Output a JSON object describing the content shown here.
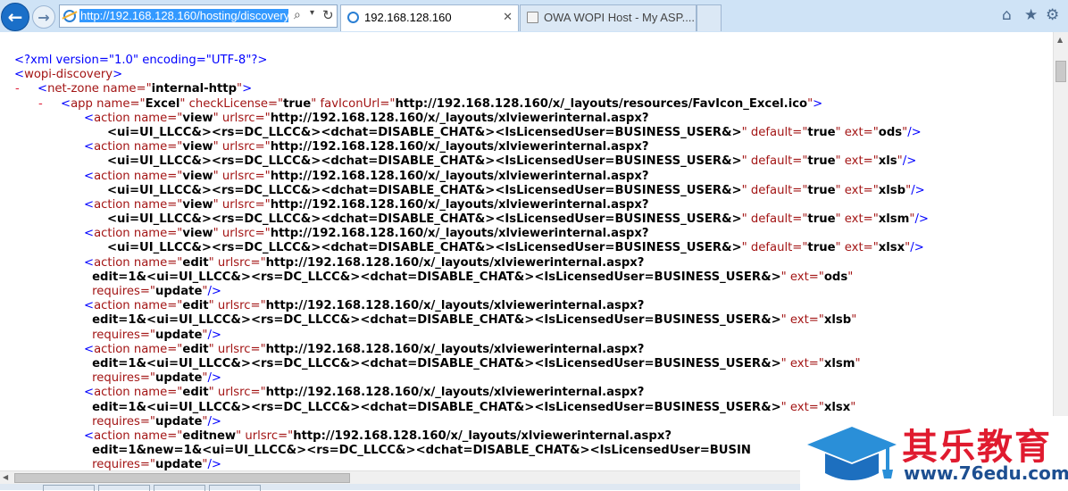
{
  "browser": {
    "address_url": "http://192.168.128.160/hosting/discovery",
    "tabs": [
      {
        "label": "192.168.128.160",
        "active": true,
        "close": "✕"
      },
      {
        "label": "OWA WOPI Host - My ASP....",
        "active": false
      }
    ],
    "icons": [
      "back-icon",
      "forward-icon",
      "search-icon",
      "refresh-icon",
      "home-icon",
      "star-icon",
      "gear-icon"
    ]
  },
  "xml": {
    "lines": [
      {
        "m": "",
        "i": 1,
        "t": [
          [
            "b",
            "<?xml version=\"1.0\" encoding=\"UTF-8\"?>"
          ]
        ]
      },
      {
        "m": "-",
        "i": 1,
        "t": [
          [
            "b",
            "<"
          ],
          [
            "r",
            "wopi-discovery"
          ],
          [
            "b",
            ">"
          ]
        ]
      },
      {
        "m": "-",
        "i": 2,
        "t": [
          [
            "b",
            "<"
          ],
          [
            "r",
            "net-zone"
          ],
          [
            "r",
            " name=\""
          ],
          [
            "k",
            "internal-http"
          ],
          [
            "r",
            "\""
          ],
          [
            "b",
            ">"
          ]
        ]
      },
      {
        "m": "-",
        "i": 3,
        "t": [
          [
            "b",
            "<"
          ],
          [
            "r",
            "app"
          ],
          [
            "r",
            " name=\""
          ],
          [
            "k",
            "Excel"
          ],
          [
            "r",
            "\" checkLicense=\""
          ],
          [
            "k",
            "true"
          ],
          [
            "r",
            "\" favIconUrl=\""
          ],
          [
            "k",
            "http://192.168.128.160/x/_layouts/resources/FavIcon_Excel.ico"
          ],
          [
            "r",
            "\""
          ],
          [
            "b",
            ">"
          ]
        ]
      },
      {
        "m": "",
        "i": 4,
        "t": [
          [
            "b",
            "<"
          ],
          [
            "r",
            "action"
          ],
          [
            "r",
            " name=\""
          ],
          [
            "k",
            "view"
          ],
          [
            "r",
            "\" urlsrc=\""
          ],
          [
            "k",
            "http://192.168.128.160/x/_layouts/xlviewerinternal.aspx?"
          ]
        ]
      },
      {
        "m": "",
        "i": 5,
        "t": [
          [
            "k",
            "<ui=UI_LLCC&><rs=DC_LLCC&><dchat=DISABLE_CHAT&><IsLicensedUser=BUSINESS_USER&>"
          ],
          [
            "r",
            "\" default=\""
          ],
          [
            "k",
            "true"
          ],
          [
            "r",
            "\" ext=\""
          ],
          [
            "k",
            "ods"
          ],
          [
            "r",
            "\""
          ],
          [
            "b",
            "/>"
          ]
        ]
      },
      {
        "m": "",
        "i": 4,
        "t": [
          [
            "b",
            "<"
          ],
          [
            "r",
            "action"
          ],
          [
            "r",
            " name=\""
          ],
          [
            "k",
            "view"
          ],
          [
            "r",
            "\" urlsrc=\""
          ],
          [
            "k",
            "http://192.168.128.160/x/_layouts/xlviewerinternal.aspx?"
          ]
        ]
      },
      {
        "m": "",
        "i": 5,
        "t": [
          [
            "k",
            "<ui=UI_LLCC&><rs=DC_LLCC&><dchat=DISABLE_CHAT&><IsLicensedUser=BUSINESS_USER&>"
          ],
          [
            "r",
            "\" default=\""
          ],
          [
            "k",
            "true"
          ],
          [
            "r",
            "\" ext=\""
          ],
          [
            "k",
            "xls"
          ],
          [
            "r",
            "\""
          ],
          [
            "b",
            "/>"
          ]
        ]
      },
      {
        "m": "",
        "i": 4,
        "t": [
          [
            "b",
            "<"
          ],
          [
            "r",
            "action"
          ],
          [
            "r",
            " name=\""
          ],
          [
            "k",
            "view"
          ],
          [
            "r",
            "\" urlsrc=\""
          ],
          [
            "k",
            "http://192.168.128.160/x/_layouts/xlviewerinternal.aspx?"
          ]
        ]
      },
      {
        "m": "",
        "i": 5,
        "t": [
          [
            "k",
            "<ui=UI_LLCC&><rs=DC_LLCC&><dchat=DISABLE_CHAT&><IsLicensedUser=BUSINESS_USER&>"
          ],
          [
            "r",
            "\" default=\""
          ],
          [
            "k",
            "true"
          ],
          [
            "r",
            "\" ext=\""
          ],
          [
            "k",
            "xlsb"
          ],
          [
            "r",
            "\""
          ],
          [
            "b",
            "/>"
          ]
        ]
      },
      {
        "m": "",
        "i": 4,
        "t": [
          [
            "b",
            "<"
          ],
          [
            "r",
            "action"
          ],
          [
            "r",
            " name=\""
          ],
          [
            "k",
            "view"
          ],
          [
            "r",
            "\" urlsrc=\""
          ],
          [
            "k",
            "http://192.168.128.160/x/_layouts/xlviewerinternal.aspx?"
          ]
        ]
      },
      {
        "m": "",
        "i": 5,
        "t": [
          [
            "k",
            "<ui=UI_LLCC&><rs=DC_LLCC&><dchat=DISABLE_CHAT&><IsLicensedUser=BUSINESS_USER&>"
          ],
          [
            "r",
            "\" default=\""
          ],
          [
            "k",
            "true"
          ],
          [
            "r",
            "\" ext=\""
          ],
          [
            "k",
            "xlsm"
          ],
          [
            "r",
            "\""
          ],
          [
            "b",
            "/>"
          ]
        ]
      },
      {
        "m": "",
        "i": 4,
        "t": [
          [
            "b",
            "<"
          ],
          [
            "r",
            "action"
          ],
          [
            "r",
            " name=\""
          ],
          [
            "k",
            "view"
          ],
          [
            "r",
            "\" urlsrc=\""
          ],
          [
            "k",
            "http://192.168.128.160/x/_layouts/xlviewerinternal.aspx?"
          ]
        ]
      },
      {
        "m": "",
        "i": 5,
        "t": [
          [
            "k",
            "<ui=UI_LLCC&><rs=DC_LLCC&><dchat=DISABLE_CHAT&><IsLicensedUser=BUSINESS_USER&>"
          ],
          [
            "r",
            "\" default=\""
          ],
          [
            "k",
            "true"
          ],
          [
            "r",
            "\" ext=\""
          ],
          [
            "k",
            "xlsx"
          ],
          [
            "r",
            "\""
          ],
          [
            "b",
            "/>"
          ]
        ]
      },
      {
        "m": "",
        "i": 4,
        "t": [
          [
            "b",
            "<"
          ],
          [
            "r",
            "action"
          ],
          [
            "r",
            " name=\""
          ],
          [
            "k",
            "edit"
          ],
          [
            "r",
            "\" urlsrc=\""
          ],
          [
            "k",
            "http://192.168.128.160/x/_layouts/xlviewerinternal.aspx?"
          ]
        ]
      },
      {
        "m": "",
        "i": 4.35,
        "t": [
          [
            "k",
            "edit=1&<ui=UI_LLCC&><rs=DC_LLCC&><dchat=DISABLE_CHAT&><IsLicensedUser=BUSINESS_USER&>"
          ],
          [
            "r",
            "\" ext=\""
          ],
          [
            "k",
            "ods"
          ],
          [
            "r",
            "\""
          ]
        ]
      },
      {
        "m": "",
        "i": 4.35,
        "t": [
          [
            "r",
            "requires=\""
          ],
          [
            "k",
            "update"
          ],
          [
            "r",
            "\""
          ],
          [
            "b",
            "/>"
          ]
        ]
      },
      {
        "m": "",
        "i": 4,
        "t": [
          [
            "b",
            "<"
          ],
          [
            "r",
            "action"
          ],
          [
            "r",
            " name=\""
          ],
          [
            "k",
            "edit"
          ],
          [
            "r",
            "\" urlsrc=\""
          ],
          [
            "k",
            "http://192.168.128.160/x/_layouts/xlviewerinternal.aspx?"
          ]
        ]
      },
      {
        "m": "",
        "i": 4.35,
        "t": [
          [
            "k",
            "edit=1&<ui=UI_LLCC&><rs=DC_LLCC&><dchat=DISABLE_CHAT&><IsLicensedUser=BUSINESS_USER&>"
          ],
          [
            "r",
            "\" ext=\""
          ],
          [
            "k",
            "xlsb"
          ],
          [
            "r",
            "\""
          ]
        ]
      },
      {
        "m": "",
        "i": 4.35,
        "t": [
          [
            "r",
            "requires=\""
          ],
          [
            "k",
            "update"
          ],
          [
            "r",
            "\""
          ],
          [
            "b",
            "/>"
          ]
        ]
      },
      {
        "m": "",
        "i": 4,
        "t": [
          [
            "b",
            "<"
          ],
          [
            "r",
            "action"
          ],
          [
            "r",
            " name=\""
          ],
          [
            "k",
            "edit"
          ],
          [
            "r",
            "\" urlsrc=\""
          ],
          [
            "k",
            "http://192.168.128.160/x/_layouts/xlviewerinternal.aspx?"
          ]
        ]
      },
      {
        "m": "",
        "i": 4.35,
        "t": [
          [
            "k",
            "edit=1&<ui=UI_LLCC&><rs=DC_LLCC&><dchat=DISABLE_CHAT&><IsLicensedUser=BUSINESS_USER&>"
          ],
          [
            "r",
            "\" ext=\""
          ],
          [
            "k",
            "xlsm"
          ],
          [
            "r",
            "\""
          ]
        ]
      },
      {
        "m": "",
        "i": 4.35,
        "t": [
          [
            "r",
            "requires=\""
          ],
          [
            "k",
            "update"
          ],
          [
            "r",
            "\""
          ],
          [
            "b",
            "/>"
          ]
        ]
      },
      {
        "m": "",
        "i": 4,
        "t": [
          [
            "b",
            "<"
          ],
          [
            "r",
            "action"
          ],
          [
            "r",
            " name=\""
          ],
          [
            "k",
            "edit"
          ],
          [
            "r",
            "\" urlsrc=\""
          ],
          [
            "k",
            "http://192.168.128.160/x/_layouts/xlviewerinternal.aspx?"
          ]
        ]
      },
      {
        "m": "",
        "i": 4.35,
        "t": [
          [
            "k",
            "edit=1&<ui=UI_LLCC&><rs=DC_LLCC&><dchat=DISABLE_CHAT&><IsLicensedUser=BUSINESS_USER&>"
          ],
          [
            "r",
            "\" ext=\""
          ],
          [
            "k",
            "xlsx"
          ],
          [
            "r",
            "\""
          ]
        ]
      },
      {
        "m": "",
        "i": 4.35,
        "t": [
          [
            "r",
            "requires=\""
          ],
          [
            "k",
            "update"
          ],
          [
            "r",
            "\""
          ],
          [
            "b",
            "/>"
          ]
        ]
      },
      {
        "m": "",
        "i": 4,
        "t": [
          [
            "b",
            "<"
          ],
          [
            "r",
            "action"
          ],
          [
            "r",
            " name=\""
          ],
          [
            "k",
            "editnew"
          ],
          [
            "r",
            "\" urlsrc=\""
          ],
          [
            "k",
            "http://192.168.128.160/x/_layouts/xlviewerinternal.aspx?"
          ]
        ]
      },
      {
        "m": "",
        "i": 4.35,
        "t": [
          [
            "k",
            "edit=1&new=1&<ui=UI_LLCC&><rs=DC_LLCC&><dchat=DISABLE_CHAT&><IsLicensedUser=BUSIN"
          ]
        ]
      },
      {
        "m": "",
        "i": 4.35,
        "t": [
          [
            "r",
            "requires=\""
          ],
          [
            "k",
            "update"
          ],
          [
            "r",
            "\""
          ],
          [
            "b",
            "/>"
          ]
        ]
      }
    ]
  },
  "watermark": {
    "brand_cn": "其乐教育",
    "site": "www.76edu.com",
    "primary_color": "#e01b2f",
    "secondary_color": "#1d4f91"
  }
}
